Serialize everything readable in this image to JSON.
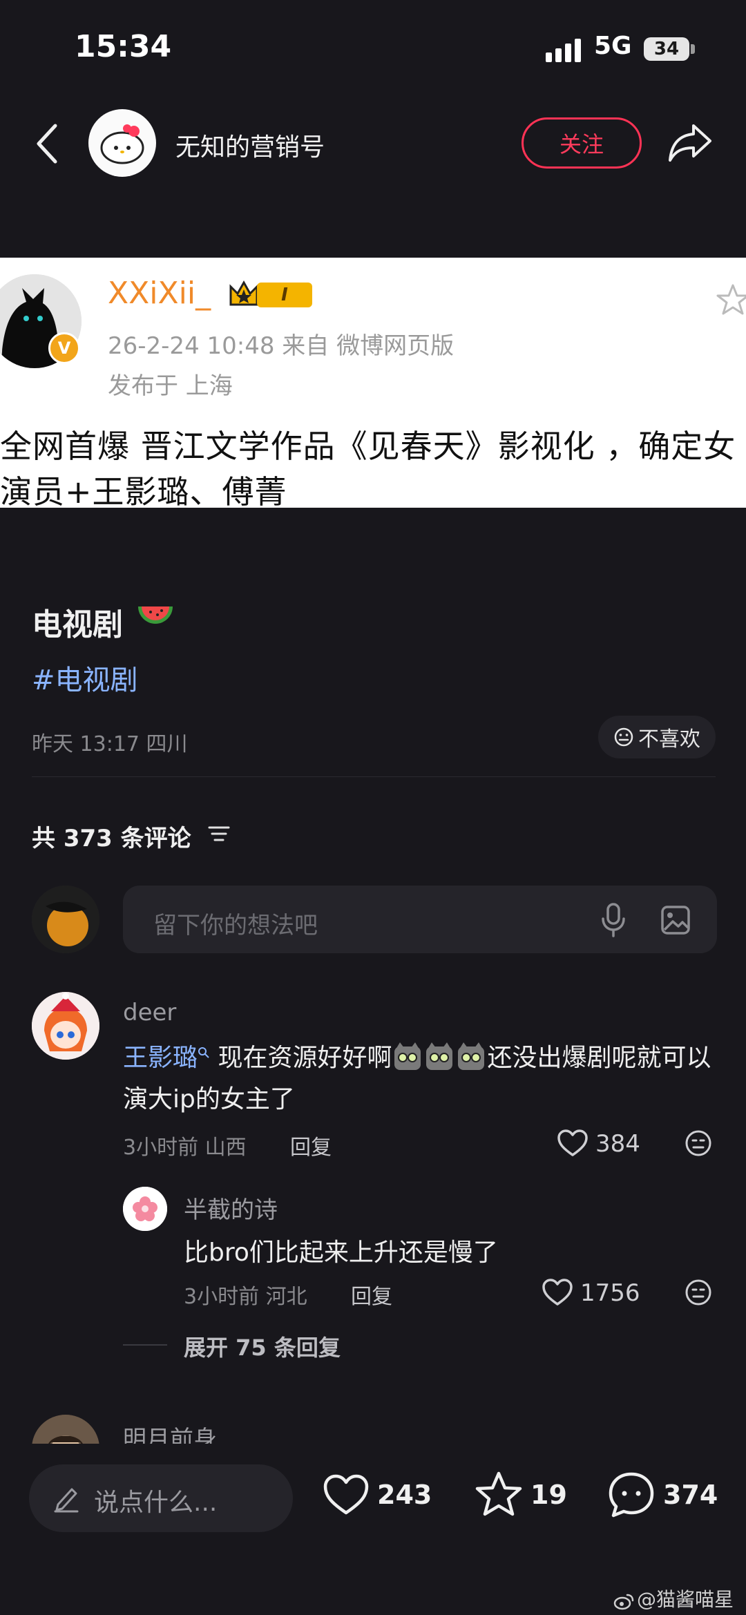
{
  "status_bar": {
    "time": "15:34",
    "network": "5G",
    "battery": "34"
  },
  "header": {
    "title": "无知的营销号",
    "follow_label": "关注"
  },
  "embedded_post": {
    "username": "XXiXii_",
    "level_badge": "I",
    "meta": "26-2-24 10:48  来自 微博网页版",
    "location": "发布于 上海",
    "text": "全网首爆  晋江文学作品《见春天》影视化 ，确定女演员+王影璐、傅菁"
  },
  "post": {
    "title": "电视剧",
    "hashtag": "#电视剧",
    "meta": "昨天 13:17 四川",
    "dislike_label": "不喜欢"
  },
  "comments": {
    "count_label": "共 373 条评论",
    "input_placeholder": "留下你的想法吧",
    "items": [
      {
        "user": "deer",
        "mention": "王影璐",
        "text_a": "现在资源好好啊",
        "text_b": "还没出爆剧呢就可以演大ip的女主了",
        "meta": "3小时前 山西",
        "reply_label": "回复",
        "likes": "384",
        "replies": [
          {
            "user": "半截的诗",
            "text": "比bro们比起来上升还是慢了",
            "meta": "3小时前 河北",
            "reply_label": "回复",
            "likes": "1756"
          }
        ],
        "expand_label": "展开 75 条回复"
      },
      {
        "user": "明月前身"
      }
    ]
  },
  "bottom_bar": {
    "placeholder": "说点什么...",
    "likes": "243",
    "stars": "19",
    "comments": "374"
  },
  "watermark": "@猫酱喵星",
  "colors": {
    "accent_red": "#ff3b5c",
    "link_blue": "#8ab4ff",
    "background": "#18171c"
  }
}
